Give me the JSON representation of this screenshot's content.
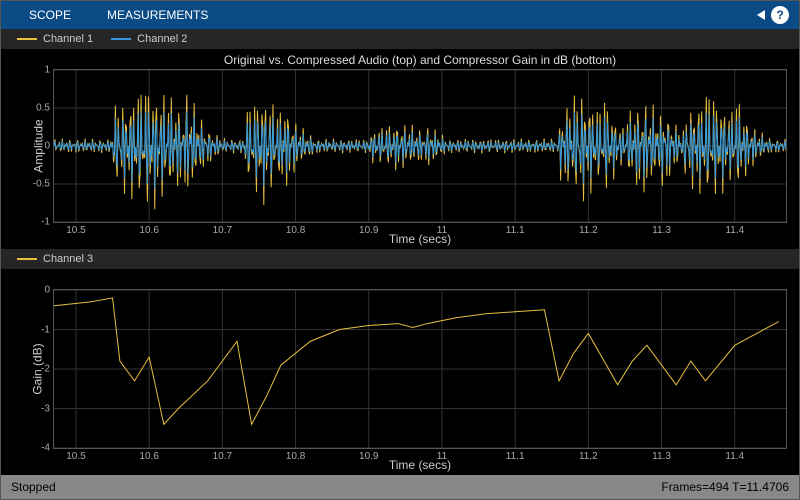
{
  "toolbar": {
    "tab_scope": "SCOPE",
    "tab_measurements": "MEASUREMENTS",
    "help": "?"
  },
  "legend_top": {
    "ch1": "Channel 1",
    "ch2": "Channel 2"
  },
  "legend_bottom": {
    "ch3": "Channel 3"
  },
  "plot1": {
    "title": "Original vs. Compressed Audio (top) and Compressor Gain in dB (bottom)",
    "ylabel": "Amplitude",
    "xlabel": "Time (secs)"
  },
  "plot2": {
    "ylabel": "Gain (dB)",
    "xlabel": "Time (secs)"
  },
  "status": {
    "left": "Stopped",
    "right": "Frames=494  T=11.4706"
  },
  "chart_data": [
    {
      "type": "line",
      "title": "Original vs. Compressed Audio (top) and Compressor Gain in dB (bottom)",
      "xlabel": "Time (secs)",
      "ylabel": "Amplitude",
      "xlim": [
        10.47,
        11.47
      ],
      "ylim": [
        -1,
        1
      ],
      "xticks": [
        10.5,
        10.6,
        10.7,
        10.8,
        10.9,
        11,
        11.1,
        11.2,
        11.3,
        11.4
      ],
      "yticks": [
        -1,
        -0.5,
        0,
        0.5,
        1
      ],
      "series": [
        {
          "name": "Channel 1",
          "color": "#e8c040",
          "description": "Original audio waveform, oscillating between roughly -0.9 and 0.9 with bursts near 10.55-10.65, 10.73-10.78, 11.16-11.40"
        },
        {
          "name": "Channel 2",
          "color": "#3498db",
          "description": "Compressed audio waveform, similar shape but attenuated peaks around ±0.6"
        }
      ]
    },
    {
      "type": "line",
      "title": "",
      "xlabel": "Time (secs)",
      "ylabel": "Gain (dB)",
      "xlim": [
        10.47,
        11.47
      ],
      "ylim": [
        -4,
        0
      ],
      "xticks": [
        10.5,
        10.6,
        10.7,
        10.8,
        10.9,
        11,
        11.1,
        11.2,
        11.3,
        11.4
      ],
      "yticks": [
        -4,
        -3,
        -2,
        -1,
        0
      ],
      "series": [
        {
          "name": "Channel 3",
          "color": "#e8c040",
          "x": [
            10.47,
            10.52,
            10.55,
            10.56,
            10.58,
            10.6,
            10.62,
            10.64,
            10.68,
            10.72,
            10.74,
            10.76,
            10.78,
            10.82,
            10.86,
            10.9,
            10.94,
            10.96,
            10.98,
            11.02,
            11.06,
            11.1,
            11.14,
            11.16,
            11.18,
            11.2,
            11.24,
            11.26,
            11.28,
            11.32,
            11.34,
            11.36,
            11.4,
            11.46
          ],
          "values": [
            -0.4,
            -0.3,
            -0.2,
            -1.8,
            -2.3,
            -1.7,
            -3.4,
            -3.0,
            -2.3,
            -1.3,
            -3.4,
            -2.7,
            -1.9,
            -1.3,
            -1.0,
            -0.9,
            -0.85,
            -0.95,
            -0.85,
            -0.7,
            -0.6,
            -0.55,
            -0.5,
            -2.3,
            -1.6,
            -1.1,
            -2.4,
            -1.8,
            -1.4,
            -2.4,
            -1.8,
            -2.3,
            -1.4,
            -0.8
          ]
        }
      ]
    }
  ]
}
